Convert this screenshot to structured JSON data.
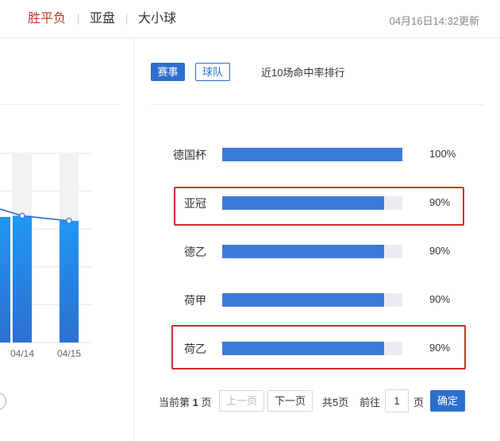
{
  "header": {
    "tabs": [
      {
        "label": "胜平负",
        "active": true
      },
      {
        "label": "亚盘",
        "active": false
      },
      {
        "label": "大小球",
        "active": false
      }
    ],
    "update_time": "04月16日14:32更新"
  },
  "chart_data": {
    "type": "bar",
    "categories": [
      "04/14",
      "04/15"
    ],
    "series": [
      {
        "values": [
          0.5,
          0.48
        ]
      }
    ],
    "line_overlay": true,
    "grid": true
  },
  "ranking": {
    "event_label": "赛事",
    "team_label": "球队",
    "title": "近10场命中率排行",
    "rows": [
      {
        "name": "德国杯",
        "rate": 100,
        "pct": "100%",
        "highlighted": false
      },
      {
        "name": "亚冠",
        "rate": 90,
        "pct": "90%",
        "highlighted": true
      },
      {
        "name": "德乙",
        "rate": 90,
        "pct": "90%",
        "highlighted": false
      },
      {
        "name": "荷甲",
        "rate": 90,
        "pct": "90%",
        "highlighted": false
      },
      {
        "name": "荷乙",
        "rate": 90,
        "pct": "90%",
        "highlighted": true
      }
    ]
  },
  "pagination": {
    "current_prefix": "当前第",
    "current_page": "1",
    "current_suffix": "页",
    "prev_label": "上一页",
    "next_label": "下一页",
    "total_label": "共5页",
    "goto_label": "前往",
    "page_value": "1",
    "page_unit": "页",
    "confirm_label": "确定"
  },
  "colors": {
    "accent": "#2d6fd0",
    "active_tab": "#c0392b",
    "highlight_border": "#d82a2a",
    "bar_fill": "#3d7bd9"
  }
}
